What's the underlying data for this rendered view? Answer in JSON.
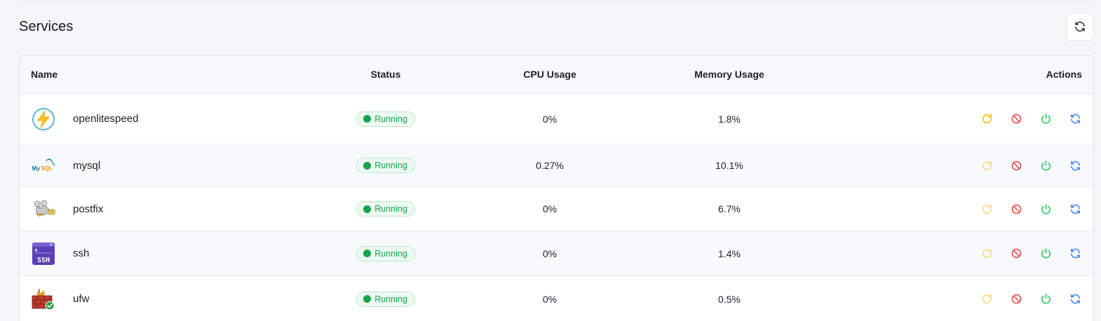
{
  "section": {
    "title": "Services",
    "refresh_icon": "refresh-icon"
  },
  "table": {
    "headers": {
      "name": "Name",
      "status": "Status",
      "cpu": "CPU Usage",
      "memory": "Memory Usage",
      "actions": "Actions"
    },
    "rows": [
      {
        "name": "openlitespeed",
        "status": "Running",
        "cpu": "0%",
        "memory": "1.8%",
        "logo": "openlitespeed-logo-icon"
      },
      {
        "name": "mysql",
        "status": "Running",
        "cpu": "0.27%",
        "memory": "10.1%",
        "logo": "mysql-logo-icon"
      },
      {
        "name": "postfix",
        "status": "Running",
        "cpu": "0%",
        "memory": "6.7%",
        "logo": "postfix-logo-icon"
      },
      {
        "name": "ssh",
        "status": "Running",
        "cpu": "0%",
        "memory": "1.4%",
        "logo": "ssh-logo-icon"
      },
      {
        "name": "ufw",
        "status": "Running",
        "cpu": "0%",
        "memory": "0.5%",
        "logo": "ufw-logo-icon"
      }
    ],
    "action_icons": [
      "restart-icon",
      "stop-icon",
      "power-icon",
      "reload-icon"
    ]
  },
  "colors": {
    "running": "#16a34a",
    "restart": "#f5b800",
    "stop": "#ef4444",
    "power": "#22c55e",
    "reload": "#3b82f6",
    "mysql_logo_text": "#00758f",
    "mysql_logo_accent": "#f29111",
    "ssh_logo": "#5b3fb8"
  },
  "logo_texts": {
    "mysql": "MySQL",
    "ssh": "SSH"
  }
}
